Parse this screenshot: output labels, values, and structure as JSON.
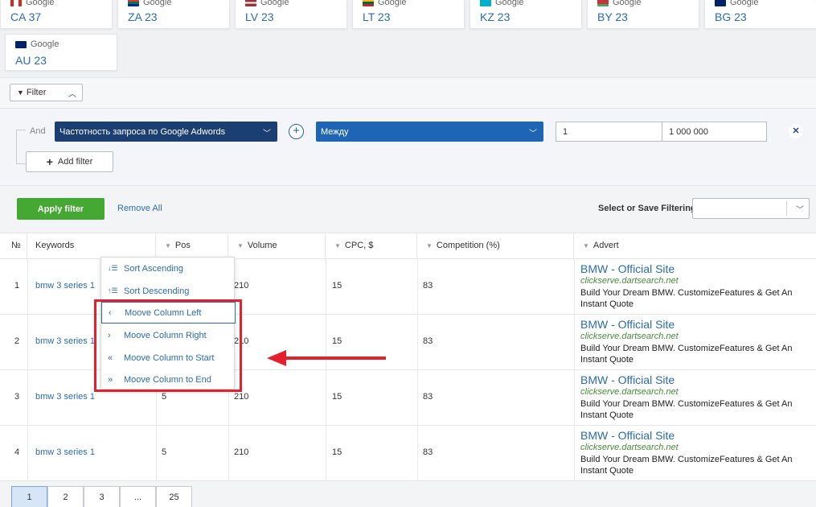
{
  "colors": {
    "accent": "#2b6cb0",
    "dark_select": "#1b3f72",
    "mid_select": "#1e65b5",
    "apply": "#44a832",
    "highlight": "#e3202b"
  },
  "regions": [
    {
      "source": "Google",
      "code": "CA 37",
      "flag": "flag-ca-icon"
    },
    {
      "source": "Google",
      "code": "ZA 23",
      "flag": "flag-za-icon"
    },
    {
      "source": "Google",
      "code": "LV 23",
      "flag": "flag-lv-icon"
    },
    {
      "source": "Google",
      "code": "LT 23",
      "flag": "flag-lt-icon"
    },
    {
      "source": "Google",
      "code": "KZ 23",
      "flag": "flag-kz-icon"
    },
    {
      "source": "Google",
      "code": "BY 23",
      "flag": "flag-by-icon"
    },
    {
      "source": "Google",
      "code": "BG 23",
      "flag": "flag-gb-icon"
    },
    {
      "source": "Google",
      "code": "AU 23",
      "flag": "flag-au-icon"
    }
  ],
  "filter_toggle": {
    "label": "Filter"
  },
  "filter": {
    "and_label": "And",
    "field": "Частотность запроса по Google Adwords",
    "operator": "Между",
    "from": "1",
    "to": "1 000 000",
    "add_filter": "Add filter"
  },
  "actions": {
    "apply": "Apply filter",
    "remove_all": "Remove All",
    "save_label": "Select or Save Filtering:",
    "save_value": ""
  },
  "table": {
    "headers": [
      "№",
      "Keywords",
      "Pos",
      "Volume",
      "CPC, $",
      "Competition (%)",
      "Advert"
    ],
    "rows": [
      {
        "n": "1",
        "keyword": "bmw 3 series 1",
        "pos": "",
        "volume": "210",
        "cpc": "15",
        "competition": "83",
        "ad_title": "BMW - Official Site",
        "ad_url": "clickserve.dartsearch.net",
        "ad_desc": "Build Your Dream BMW. CustomizeFeatures & Get An Instant Quote"
      },
      {
        "n": "2",
        "keyword": "bmw 3 series 1",
        "pos": "",
        "volume": "210",
        "cpc": "15",
        "competition": "83",
        "ad_title": "BMW - Official Site",
        "ad_url": "clickserve.dartsearch.net",
        "ad_desc": "Build Your Dream BMW. CustomizeFeatures & Get An Instant Quote"
      },
      {
        "n": "3",
        "keyword": "bmw 3 series 1",
        "pos": "5",
        "volume": "210",
        "cpc": "15",
        "competition": "83",
        "ad_title": "BMW - Official Site",
        "ad_url": "clickserve.dartsearch.net",
        "ad_desc": "Build Your Dream BMW. CustomizeFeatures & Get An Instant Quote"
      },
      {
        "n": "4",
        "keyword": "bmw 3 series 1",
        "pos": "5",
        "volume": "210",
        "cpc": "15",
        "competition": "83",
        "ad_title": "BMW - Official Site",
        "ad_url": "clickserve.dartsearch.net",
        "ad_desc": "Build Your Dream BMW. CustomizeFeatures & Get An Instant Quote"
      }
    ]
  },
  "column_menu": {
    "items": [
      {
        "label": "Sort Ascending",
        "icon": "sort-ascending-icon",
        "glyph": "↓☰"
      },
      {
        "label": "Sort Descending",
        "icon": "sort-descending-icon",
        "glyph": "↑☰"
      },
      {
        "label": "Moove Column Left",
        "icon": "chevron-left-icon",
        "glyph": "‹"
      },
      {
        "label": "Moove Column Right",
        "icon": "chevron-right-icon",
        "glyph": "›"
      },
      {
        "label": "Moove Column to Start",
        "icon": "double-chevron-left-icon",
        "glyph": "«"
      },
      {
        "label": "Moove Column to End",
        "icon": "double-chevron-right-icon",
        "glyph": "»"
      }
    ]
  },
  "pagination": {
    "pages": [
      "1",
      "2",
      "3",
      "...",
      "25"
    ],
    "current": "1"
  }
}
